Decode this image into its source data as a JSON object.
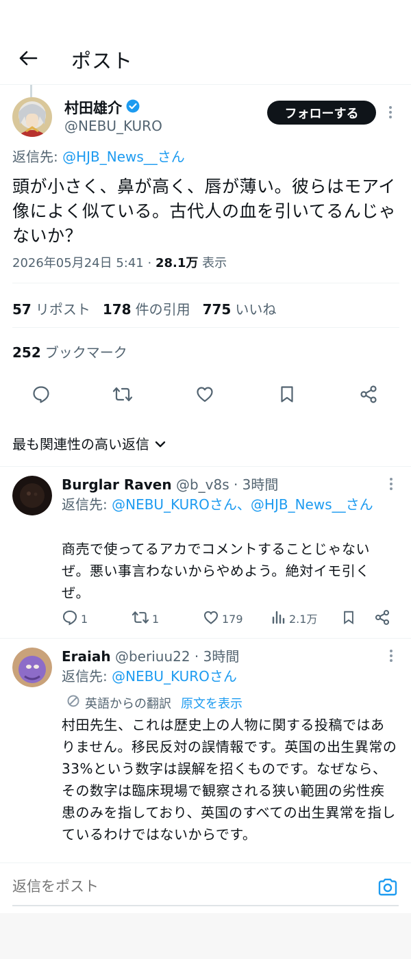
{
  "header": {
    "title": "ポスト"
  },
  "main_post": {
    "author_name": "村田雄介",
    "handle": "@NEBU_KURO",
    "follow_label": "フォローする",
    "replying_prefix": "返信先: ",
    "replying_to": "@HJB_News__さん",
    "text": "頭が小さく、鼻が高く、唇が薄い。彼らはモアイ像によく似ている。古代人の血を引いてるんじゃないか？",
    "timestamp": "2026年05月24日 5:41",
    "views_count": "28.1万",
    "views_label": "表示",
    "reposts_count": "57",
    "reposts_label": "リポスト",
    "quotes_count": "178",
    "quotes_label": "件の引用",
    "likes_count": "775",
    "likes_label": "いいね",
    "bookmarks_count": "252",
    "bookmarks_label": "ブックマーク"
  },
  "sort_label": "最も関連性の高い返信",
  "replies": [
    {
      "name": "Burglar Raven",
      "handle": "@b_v8s · 3時間",
      "replying_prefix": "返信先: ",
      "replying_to": "@NEBU_KUROさん、@HJB_News__さん",
      "text": "商売で使ってるアカでコメントすることじゃないぜ。悪い事言わないからやめよう。絶対イモ引くぜ。",
      "reply_count": "1",
      "repost_count": "1",
      "like_count": "179",
      "views_count": "2.1万"
    },
    {
      "name": "Eraiah",
      "handle": "@beriuu22 · 3時間",
      "replying_prefix": "返信先: ",
      "replying_to": "@NEBU_KUROさん",
      "translated_label": "英語からの翻訳",
      "show_original_label": "原文を表示",
      "text": "村田先生、これは歴史上の人物に関する投稿ではありません。移民反対の誤情報です。英国の出生異常の33%という数字は誤解を招くものです。なぜなら、その数字は臨床現場で観察される狭い範囲の劣性疾患のみを指しており、英国のすべての出生異常を指しているわけではないからです。"
    }
  ],
  "compose": {
    "placeholder": "返信をポスト"
  },
  "icons": [
    "back-arrow-icon",
    "verified-badge-icon",
    "more-icon",
    "reply-icon",
    "repost-icon",
    "like-icon",
    "bookmark-icon",
    "share-icon",
    "chevron-down-icon",
    "views-icon",
    "translate-icon",
    "camera-icon"
  ],
  "colors": {
    "accent": "#1d9bf0",
    "text": "#0f1419",
    "muted": "#536471",
    "follow_bg": "#0f1419"
  }
}
